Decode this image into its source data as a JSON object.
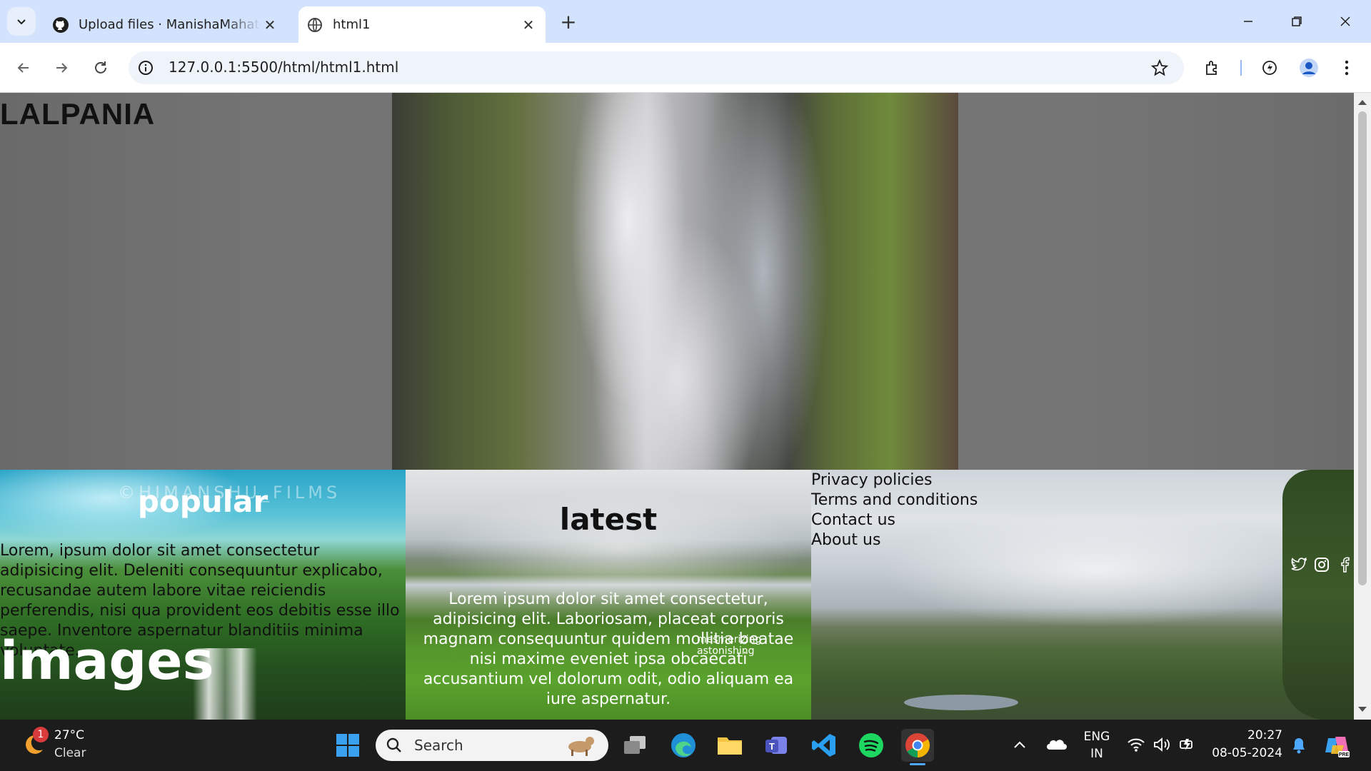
{
  "browser": {
    "tabs": [
      {
        "title": "Upload files · ManishaMahato/C",
        "favicon": "github-icon"
      },
      {
        "title": "html1",
        "favicon": "globe-icon"
      }
    ],
    "url": "127.0.0.1:5500/html/html1.html"
  },
  "page": {
    "logo": "LALPANIA",
    "cards": {
      "popular": {
        "watermark": "©HIMANSHU_FILMS",
        "heading": "popular",
        "text": "Lorem, ipsum dolor sit amet consectetur adipisicing elit. Deleniti consequuntur explicabo, recusandae autem labore vitae reiciendis perferendis, nisi qua provident eos debitis esse illo saepe. Inventore aspernatur blanditiis minima voluptate.",
        "caption": "images"
      },
      "latest": {
        "heading": "latest",
        "text": "Lorem ipsum dolor sit amet consectetur, adipisicing elit. Laboriosam, placeat corporis magnam consequuntur quidem mollitia beatae nisi maxime eveniet ipsa obcaecati accusantium vel dolorum odit, odio aliquam ea iure aspernatur.",
        "tag1": "mesmerizing",
        "tag2": "astonishing"
      }
    },
    "footer_links": [
      "Privacy policies",
      "Terms and conditions",
      "Contact us",
      "About us"
    ],
    "social_icons": [
      "twitter-icon",
      "instagram-icon",
      "facebook-icon"
    ]
  },
  "taskbar": {
    "weather": {
      "temp": "27°C",
      "condition": "Clear",
      "badge": "1"
    },
    "search_placeholder": "Search",
    "language": {
      "lang": "ENG",
      "region": "IN"
    },
    "time": "20:27",
    "date": "08-05-2024"
  }
}
